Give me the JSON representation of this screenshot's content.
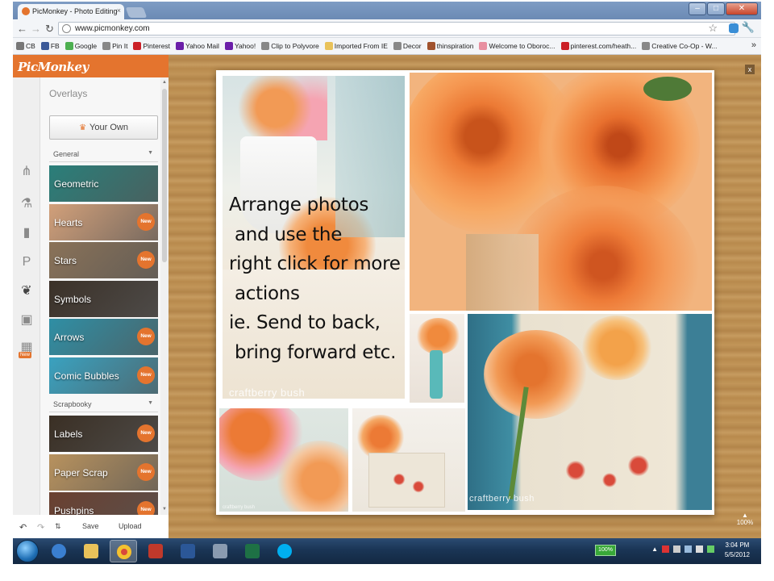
{
  "browser": {
    "tab_title": "PicMonkey - Photo Editing",
    "tab_close": "×",
    "url": "www.picmonkey.com",
    "bookmarks": [
      {
        "label": "CB",
        "color": "#777777"
      },
      {
        "label": "FB",
        "color": "#3b5998"
      },
      {
        "label": "Google",
        "color": "#4caf50"
      },
      {
        "label": "Pin It",
        "color": "#888888"
      },
      {
        "label": "Pinterest",
        "color": "#cb2027"
      },
      {
        "label": "Yahoo Mail",
        "color": "#6b1ea8"
      },
      {
        "label": "Yahoo!",
        "color": "#6b1ea8"
      },
      {
        "label": "Clip to Polyvore",
        "color": "#888888"
      },
      {
        "label": "Imported From IE",
        "color": "#e9c25a"
      },
      {
        "label": "Decor",
        "color": "#888888"
      },
      {
        "label": "thinspiration",
        "color": "#a0522d"
      },
      {
        "label": "Welcome to Oboroc...",
        "color": "#e88fa0"
      },
      {
        "label": "pinterest.com/heath...",
        "color": "#cb2027"
      },
      {
        "label": "Creative Co-Op - W...",
        "color": "#888888"
      }
    ],
    "more": "»"
  },
  "app": {
    "logo": "PicMonkey",
    "panel_title": "Overlays",
    "your_own": "Your Own",
    "sections": {
      "general": "General",
      "scrapbooky": "Scrapbooky"
    },
    "items": [
      {
        "label": "Geometric",
        "is_new": false,
        "bg": "#2a7f7a"
      },
      {
        "label": "Hearts",
        "is_new": true,
        "bg": "#d2a07a"
      },
      {
        "label": "Stars",
        "is_new": true,
        "bg": "#8a7258"
      },
      {
        "label": "Symbols",
        "is_new": false,
        "bg": "#3b3128"
      },
      {
        "label": "Arrows",
        "is_new": true,
        "bg": "#2f8fa5"
      },
      {
        "label": "Comic Bubbles",
        "is_new": true,
        "bg": "#3aa2c0"
      },
      {
        "label": "Labels",
        "is_new": true,
        "bg": "#3a2f24"
      },
      {
        "label": "Paper Scrap",
        "is_new": true,
        "bg": "#b8925e"
      },
      {
        "label": "Pushpins",
        "is_new": true,
        "bg": "#6a4030"
      }
    ],
    "new_badge": "New",
    "bottom": {
      "save": "Save",
      "upload": "Upload"
    },
    "close": "x",
    "zoom": "100%"
  },
  "collage": {
    "text_lines": [
      "Arrange photos",
      " and use the",
      "right click for more",
      " actions",
      "ie. Send to back,",
      " bring forward etc."
    ],
    "watermark": "craftberry bush",
    "small_watermark": "craftberry bush"
  },
  "taskbar": {
    "battery": "100%",
    "time": "3:04 PM",
    "date": "5/5/2012"
  }
}
